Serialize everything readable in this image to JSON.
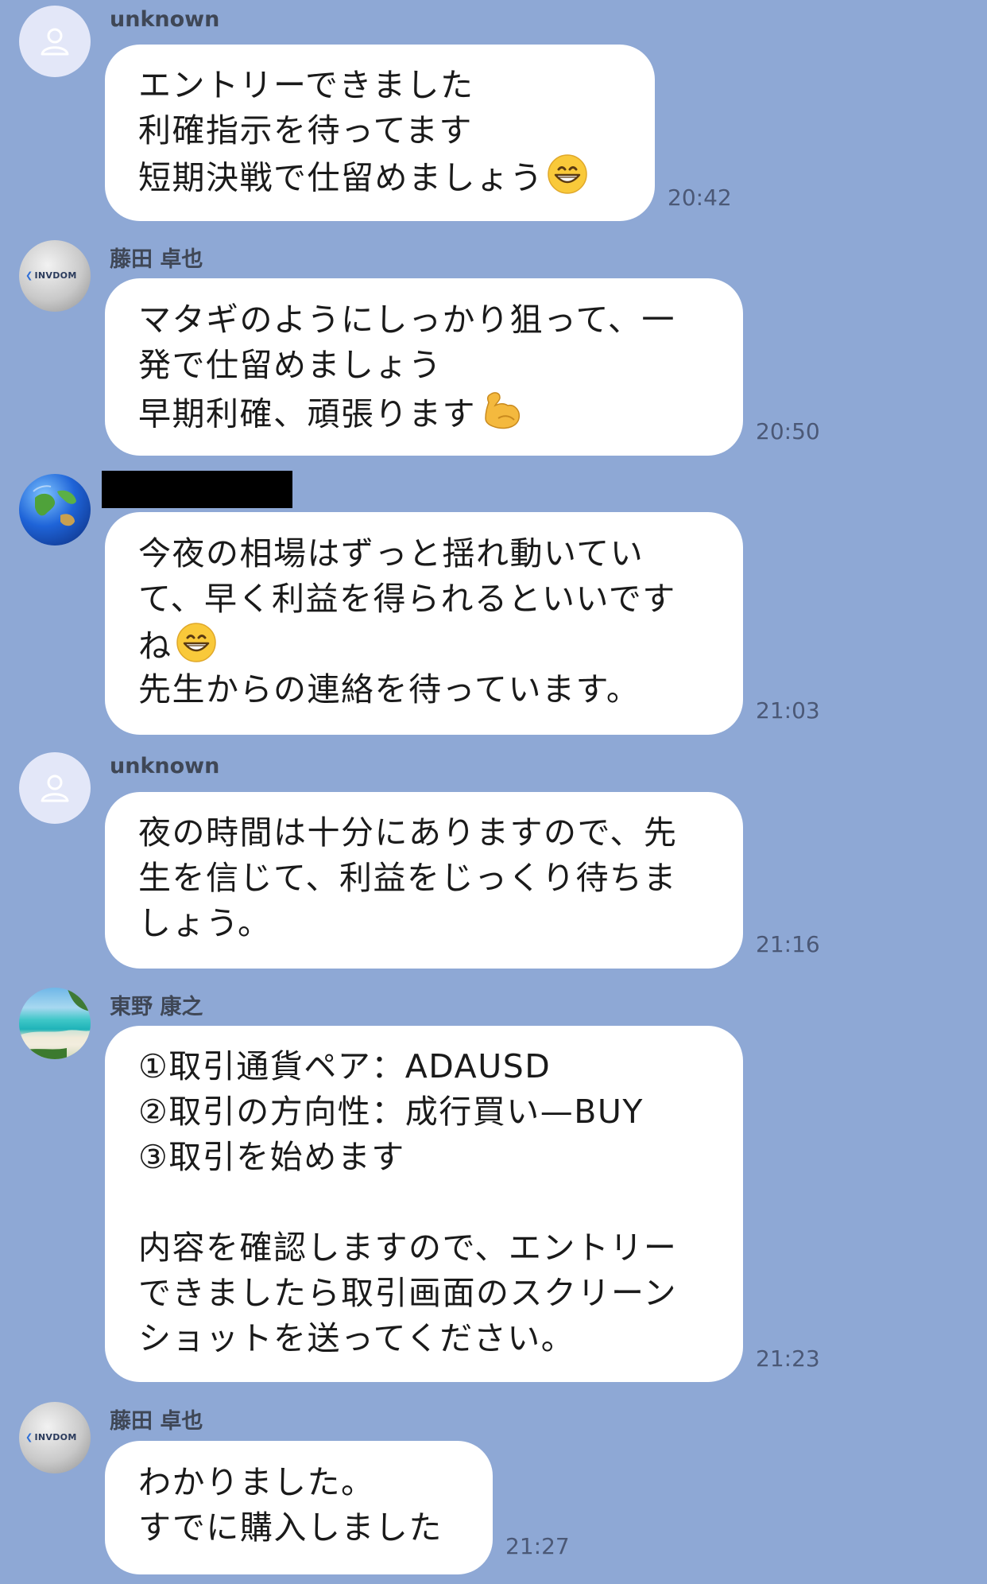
{
  "messages": [
    {
      "sender": "unknown",
      "lines": [
        "エントリーできました",
        "利確指示を待ってます",
        "短期決戦で仕留めましょう"
      ],
      "time": "20:42"
    },
    {
      "sender": "藤田 卓也",
      "avatar_text": "INVDOM",
      "lines": [
        "マタギのようにしっかり狙って、一",
        "発で仕留めましょう",
        "早期利確、頑張ります"
      ],
      "time": "20:50"
    },
    {
      "sender": "",
      "lines": [
        "今夜の相場はずっと揺れ動いてい",
        "て、早く利益を得られるといいです",
        "ね",
        "先生からの連絡を待っています。"
      ],
      "time": "21:03"
    },
    {
      "sender": "unknown",
      "lines": [
        "夜の時間は十分にありますので、先",
        "生を信じて、利益をじっくり待ちま",
        "しょう。"
      ],
      "time": "21:16"
    },
    {
      "sender": "東野  康之",
      "lines": [
        "①取引通貨ペア：ADAUSD",
        "②取引の方向性：成行買い—BUY",
        "③取引を始めます",
        "",
        "内容を確認しますので、エントリー",
        "できましたら取引画面のスクリーン",
        "ショットを送ってください。"
      ],
      "time": "21:23"
    },
    {
      "sender": "藤田 卓也",
      "avatar_text": "INVDOM",
      "lines": [
        "わかりました。",
        "すでに購入しました"
      ],
      "time": "21:27"
    }
  ],
  "icons": {
    "grin": "grinning-face-emoji",
    "muscle": "flexed-biceps-emoji",
    "default_avatar": "person-icon"
  },
  "colors": {
    "background": "#8EA8D5",
    "bubble": "#FFFFFF",
    "name_text": "#3f4756",
    "time_text": "#4b5876"
  }
}
